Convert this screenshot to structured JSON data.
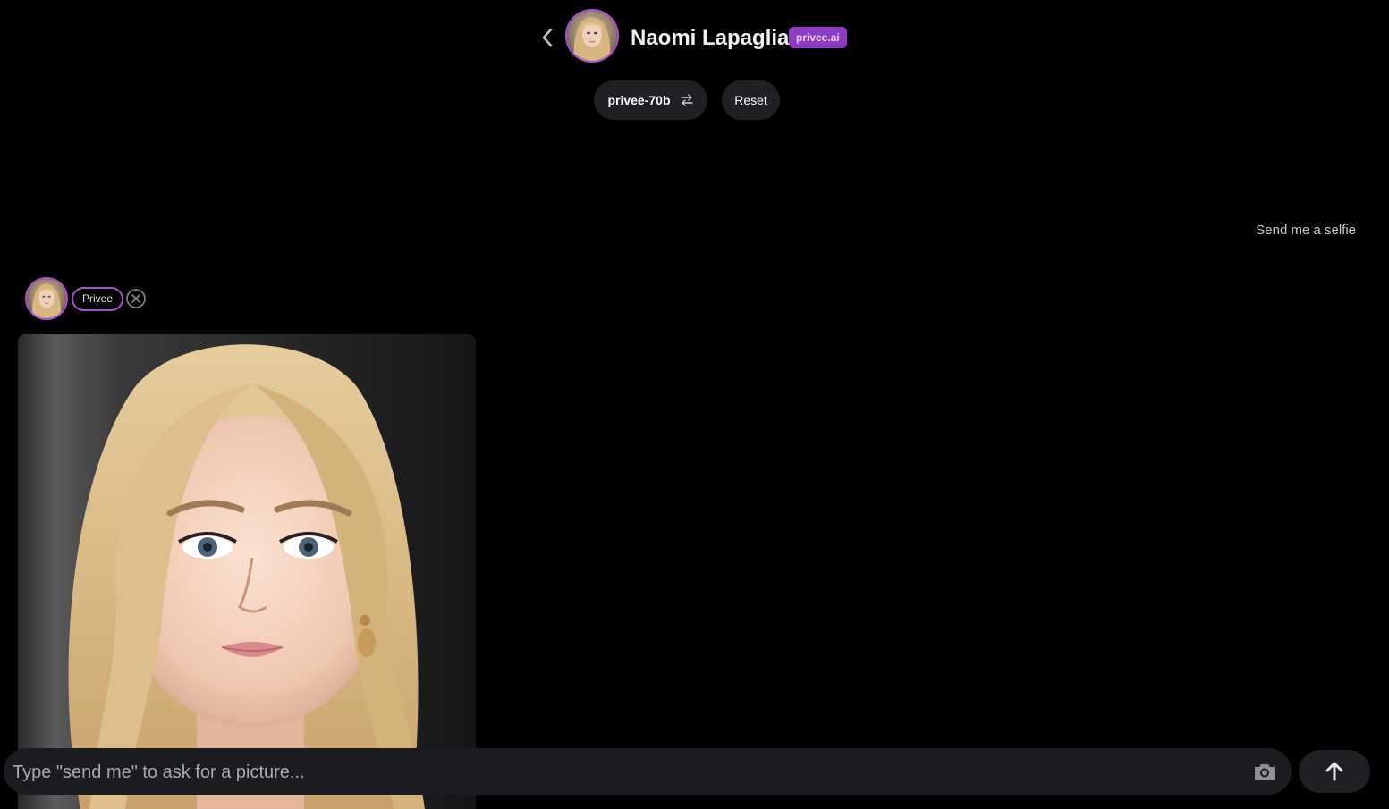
{
  "header": {
    "title": "Naomi Lapaglia",
    "badge": "privee.ai",
    "back_icon": "chevron-left-icon",
    "avatar_alt": "avatar"
  },
  "controls": {
    "model_label": "privee-70b",
    "model_icon": "swap-arrows-icon",
    "reset_label": "Reset"
  },
  "messages": [
    {
      "role": "user",
      "text": "Send me a selfie"
    },
    {
      "role": "bot",
      "tag": "Privee",
      "close_icon": "close-circle-icon",
      "content_type": "image"
    }
  ],
  "composer": {
    "placeholder": "Type \"send me\" to ask for a picture...",
    "value": "",
    "camera_icon": "camera-icon",
    "send_icon": "arrow-up-icon"
  },
  "colors": {
    "background": "#000000",
    "accent": "#b14fd8",
    "badge": "#8e3bc4",
    "pill": "#1f2023",
    "input": "#1b1c1f"
  }
}
